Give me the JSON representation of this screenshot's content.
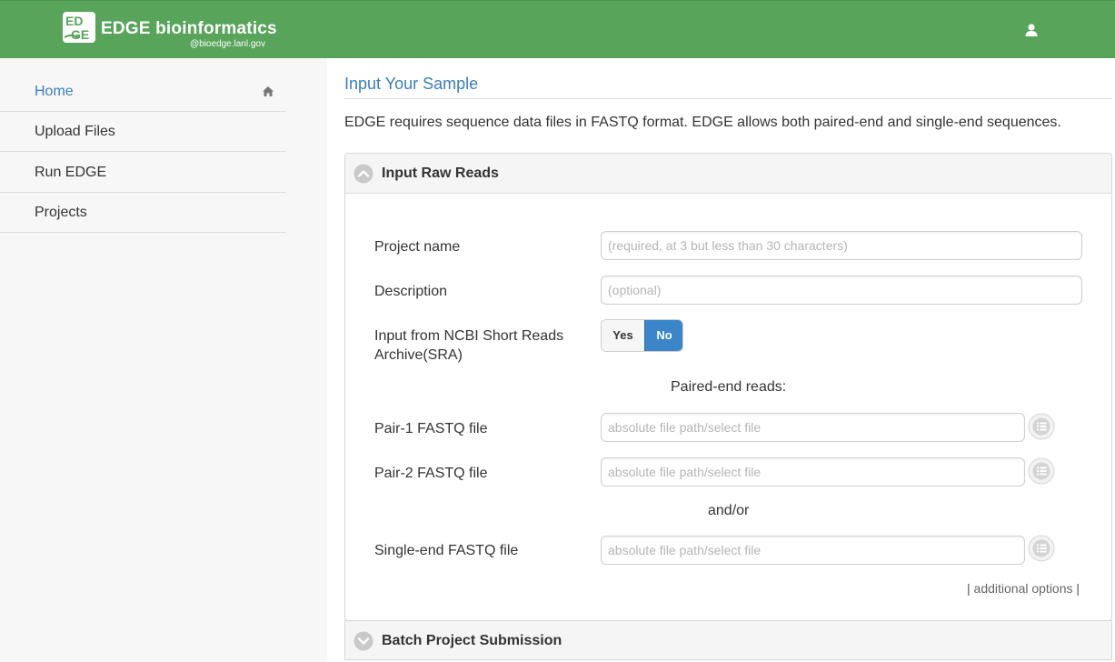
{
  "header": {
    "brand": "EDGE bioinformatics",
    "subdomain": "@bioedge.lanl.gov",
    "logo_icon": "edge-logo-icon",
    "user_icon": "user-icon",
    "bg_color": "#57a45a"
  },
  "sidebar": {
    "items": [
      {
        "label": "Home",
        "active": true,
        "icon": "home-icon"
      },
      {
        "label": "Upload Files"
      },
      {
        "label": "Run EDGE"
      },
      {
        "label": "Projects"
      }
    ]
  },
  "main": {
    "title": "Input Your Sample",
    "intro": "EDGE requires sequence data files in FASTQ format. EDGE allows both paired-end and single-end sequences.",
    "panel": {
      "title": "Input Raw Reads",
      "project_name_label": "Project name",
      "project_name_placeholder": "(required, at 3 but less than 30 characters)",
      "description_label": "Description",
      "description_placeholder": "(optional)",
      "sra_label": "Input from NCBI Short Reads Archive(SRA)",
      "sra_yes": "Yes",
      "sra_no": "No",
      "sra_selected": "No",
      "paired_heading": "Paired-end reads:",
      "pair1_label": "Pair-1 FASTQ file",
      "pair2_label": "Pair-2 FASTQ file",
      "andor": "and/or",
      "single_label": "Single-end FASTQ file",
      "file_placeholder": "absolute file path/select file",
      "browse_icon": "list-icon",
      "addl_prefix": "|",
      "addl_link": "additional options",
      "addl_suffix": "|"
    },
    "panel2": {
      "title": "Batch Project Submission"
    }
  }
}
